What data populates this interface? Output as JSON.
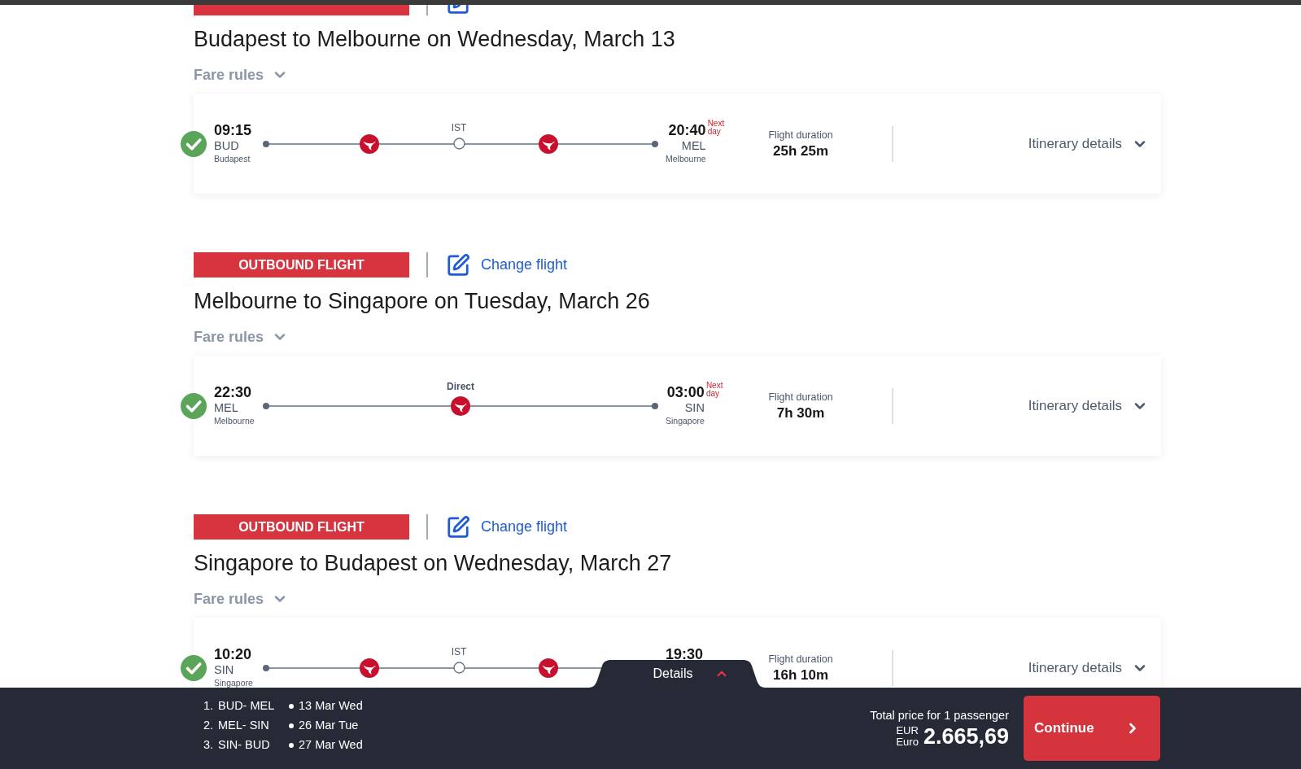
{
  "segments": [
    {
      "title": "Budapest to Melbourne on Wednesday, March 13",
      "fare_rules": "Fare rules",
      "confirmed": true,
      "departure": {
        "time": "09:15",
        "code": "BUD",
        "city": "Budapest"
      },
      "stops": [
        {
          "kind": "plane"
        },
        {
          "kind": "stop",
          "label": "IST"
        },
        {
          "kind": "plane"
        }
      ],
      "arrival": {
        "time": "20:40",
        "code": "MEL",
        "city": "Melbourne",
        "note": "Next day"
      },
      "duration_label": "Flight duration",
      "duration": "25h 25m",
      "itinerary_link": "Itinerary details"
    },
    {
      "badge": "OUTBOUND FLIGHT",
      "change_link": "Change flight",
      "title": "Melbourne to Singapore on Tuesday, March 26",
      "fare_rules": "Fare rules",
      "confirmed": true,
      "departure": {
        "time": "22:30",
        "code": "MEL",
        "city": "Melbourne"
      },
      "stops": [
        {
          "kind": "plane",
          "label": "Direct"
        }
      ],
      "arrival": {
        "time": "03:00",
        "code": "SIN",
        "city": "Singapore",
        "note": "Next day"
      },
      "duration_label": "Flight duration",
      "duration": "7h 30m",
      "itinerary_link": "Itinerary details"
    },
    {
      "badge": "OUTBOUND FLIGHT",
      "change_link": "Change flight",
      "title": "Singapore to Budapest on Wednesday, March 27",
      "fare_rules": "Fare rules",
      "confirmed": true,
      "departure": {
        "time": "10:20",
        "code": "SIN",
        "city": "Singapore"
      },
      "stops": [
        {
          "kind": "plane"
        },
        {
          "kind": "stop",
          "label": "IST"
        },
        {
          "kind": "plane"
        }
      ],
      "arrival": {
        "time": "19:30"
      },
      "duration_label": "Flight duration",
      "duration": "16h 10m",
      "itinerary_link": "Itinerary details"
    }
  ],
  "details_tab": {
    "label": "Details"
  },
  "summary": [
    {
      "index": "1.",
      "route": "BUD- MEL",
      "date": "13 Mar Wed"
    },
    {
      "index": "2.",
      "route": "MEL- SIN",
      "date": "26 Mar Tue"
    },
    {
      "index": "3.",
      "route": "SIN- BUD",
      "date": "27 Mar Wed"
    }
  ],
  "price": {
    "caption": "Total price for 1 passenger",
    "currency_code": "EUR",
    "currency_name": "Euro",
    "amount": "2.665,69"
  },
  "continue_button": "Continue"
}
